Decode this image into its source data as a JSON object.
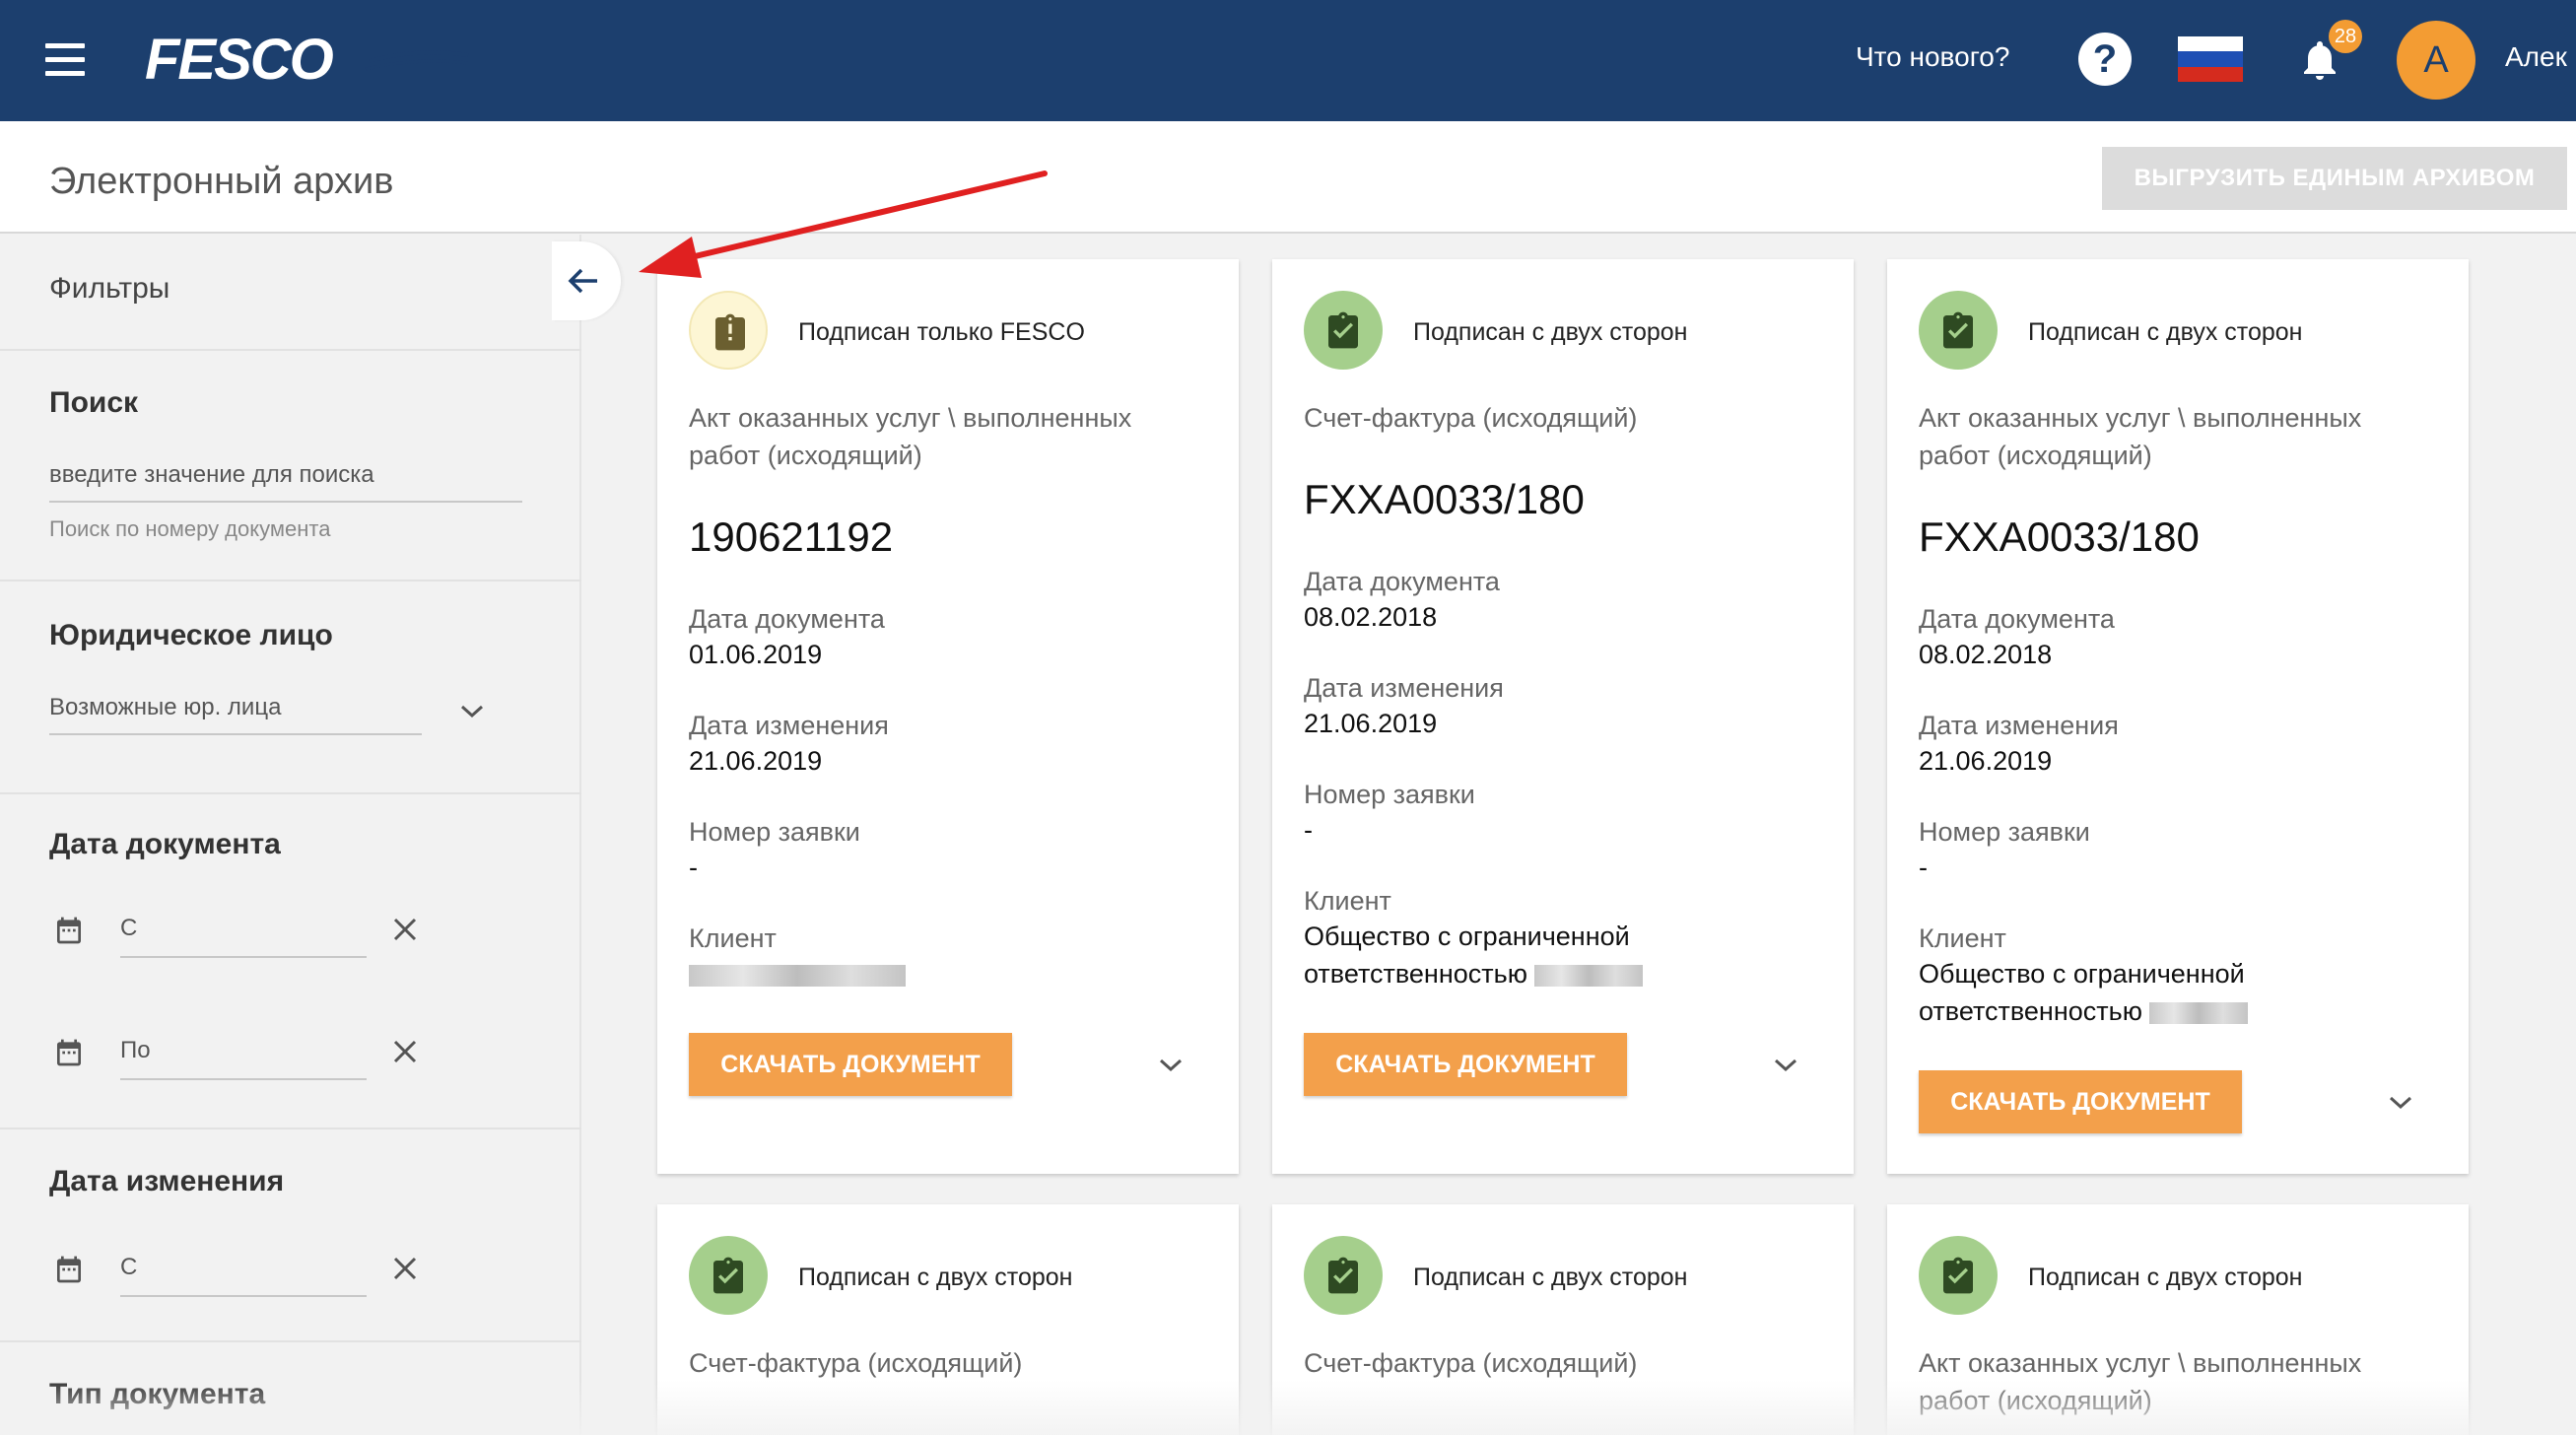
{
  "topbar": {
    "logo_text": "FESCO",
    "whats_new": "Что нового?",
    "help_icon": "help-circle-icon",
    "flag_icon": "russia-flag-icon",
    "bell_icon": "bell-icon",
    "notifications_count": "28",
    "avatar_letter": "А",
    "user_name": "Алек"
  },
  "header": {
    "title": "Электронный архив",
    "export_label": "ВЫГРУЗИТЬ ЕДИНЫМ АРХИВОМ"
  },
  "sidebar": {
    "filters_title": "Фильтры",
    "search": {
      "title": "Поиск",
      "placeholder": "введите значение для поиска",
      "hint": "Поиск по номеру документа"
    },
    "legal_entity": {
      "title": "Юридическое лицо",
      "placeholder": "Возможные юр. лица"
    },
    "doc_date": {
      "title": "Дата документа",
      "from": "С",
      "to": "По"
    },
    "change_date": {
      "title": "Дата изменения",
      "from": "С"
    },
    "doc_type": {
      "title": "Тип документа"
    }
  },
  "cards": [
    {
      "status": "Подписан только FESCO",
      "doc_type": "Акт оказанных услуг \\ выполненных работ (исходящий)",
      "number": "190621192",
      "doc_date_label": "Дата документа",
      "doc_date": "01.06.2019",
      "change_date_label": "Дата изменения",
      "change_date": "21.06.2019",
      "request_label": "Номер заявки",
      "request": "-",
      "client_label": "Клиент",
      "client_line1": "",
      "client_line2": "",
      "download": "СКАЧАТЬ ДОКУМЕНТ"
    },
    {
      "status": "Подписан с двух сторон",
      "doc_type": "Счет-фактура (исходящий)",
      "number": "FXXA0033/180",
      "doc_date_label": "Дата документа",
      "doc_date": "08.02.2018",
      "change_date_label": "Дата изменения",
      "change_date": "21.06.2019",
      "request_label": "Номер заявки",
      "request": "-",
      "client_label": "Клиент",
      "client_line1": "Общество с ограниченной",
      "client_line2": "ответственностью",
      "download": "СКАЧАТЬ ДОКУМЕНТ"
    },
    {
      "status": "Подписан с двух сторон",
      "doc_type": "Акт оказанных услуг \\ выполненных работ (исходящий)",
      "number": "FXXA0033/180",
      "doc_date_label": "Дата документа",
      "doc_date": "08.02.2018",
      "change_date_label": "Дата изменения",
      "change_date": "21.06.2019",
      "request_label": "Номер заявки",
      "request": "-",
      "client_label": "Клиент",
      "client_line1": "Общество с ограниченной",
      "client_line2": "ответственностью",
      "download": "СКАЧАТЬ ДОКУМЕНТ"
    },
    {
      "status": "Подписан с двух сторон",
      "doc_type": "Счет-фактура (исходящий)"
    },
    {
      "status": "Подписан с двух сторон",
      "doc_type": "Счет-фактура (исходящий)"
    },
    {
      "status": "Подписан с двух сторон",
      "doc_type": "Акт оказанных услуг \\ выполненных работ (исходящий)"
    }
  ],
  "colors": {
    "topbar": "#1c3f6e",
    "accent": "#f3a04b",
    "status_ok": "#a5cf8c",
    "status_warn": "#fdf6d4",
    "annotation": "#e02020"
  }
}
